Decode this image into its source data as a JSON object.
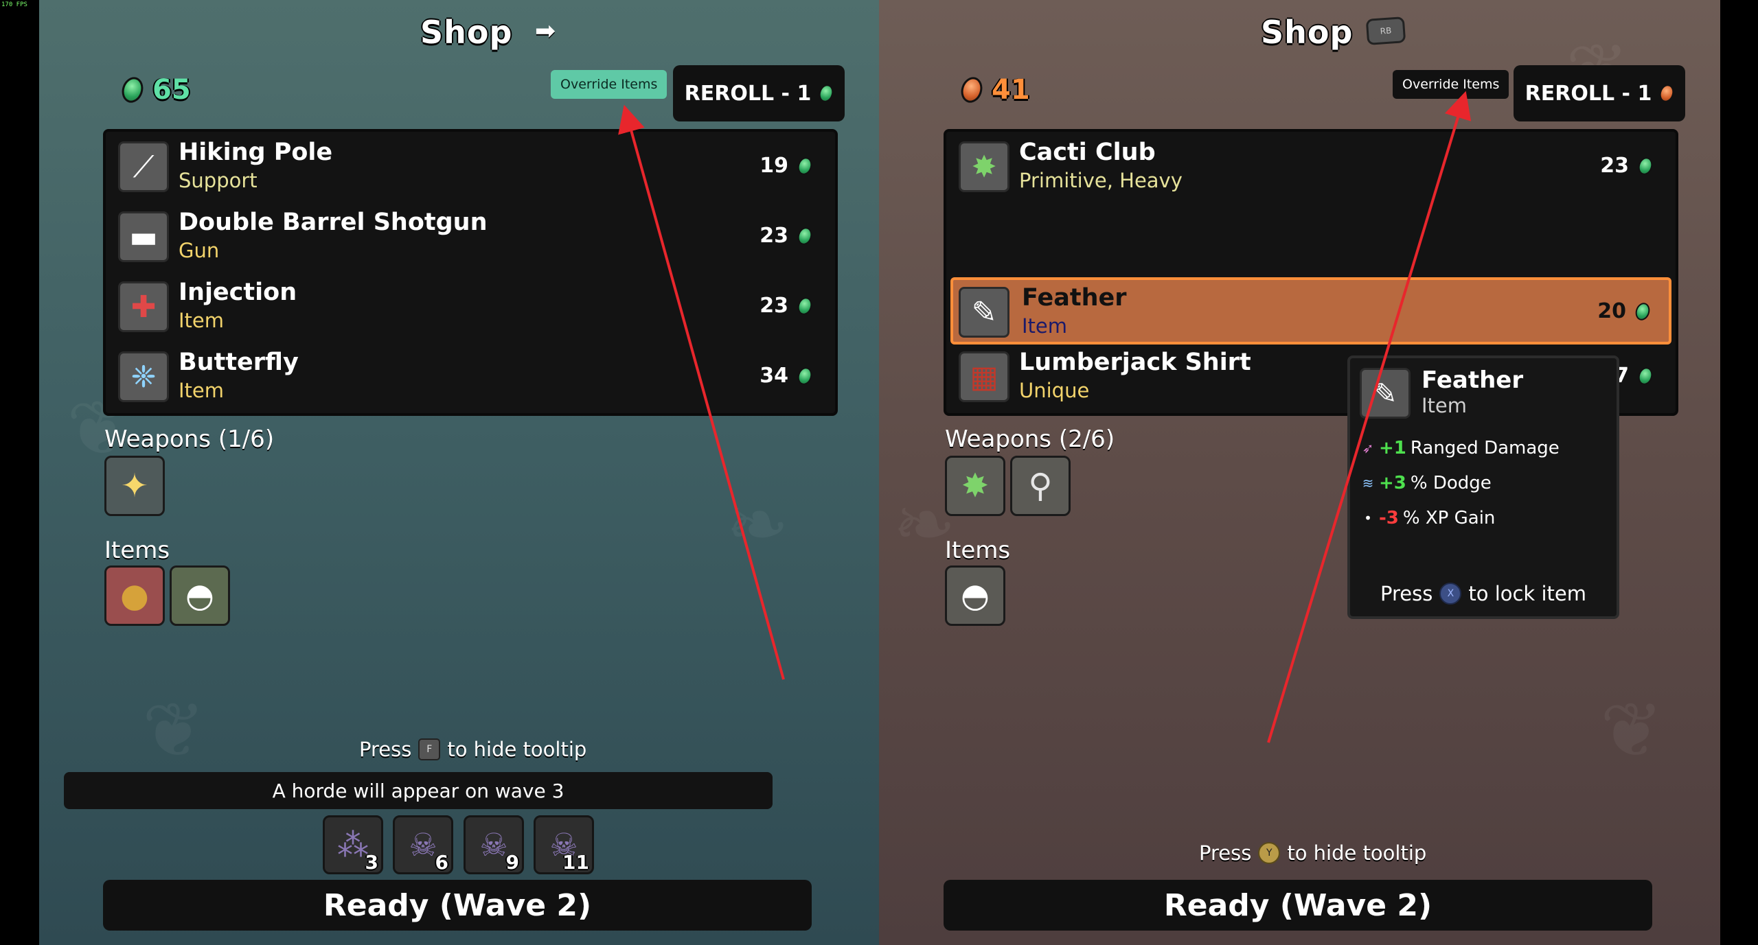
{
  "fps": "170 FPS",
  "colors": {
    "left_accent": "#5fc9a6",
    "right_accent": "#ff8f3a",
    "support_type": "#e6e29a",
    "arrow_red": "#e8262c"
  },
  "left": {
    "title": "Shop",
    "title_icon": "arrow-right-icon",
    "materials": "65",
    "override_label": "Override Items",
    "reroll_label": "REROLL - 1",
    "items": [
      {
        "name": "Hiking Pole",
        "type": "Support",
        "price": "19",
        "icon": "hiking-pole-icon"
      },
      {
        "name": "Double Barrel Shotgun",
        "type": "Gun",
        "price": "23",
        "icon": "shotgun-icon"
      },
      {
        "name": "Injection",
        "type": "Item",
        "price": "23",
        "icon": "syringe-icon"
      },
      {
        "name": "Butterfly",
        "type": "Item",
        "price": "34",
        "icon": "butterfly-icon"
      }
    ],
    "weapons_label": "Weapons (1/6)",
    "items_label": "Items",
    "press_prefix": "Press",
    "press_key": "F",
    "press_suffix": "to hide tooltip",
    "horde_text": "A horde will appear on wave 3",
    "enemies": [
      "3",
      "6",
      "9",
      "11"
    ],
    "ready_label": "Ready (Wave 2)"
  },
  "right": {
    "title": "Shop",
    "title_icon": "rb-button-icon",
    "title_icon_label": "RB",
    "materials": "41",
    "override_label": "Override Items",
    "reroll_label": "REROLL - 1",
    "items": [
      {
        "name": "Cacti Club",
        "type": "Primitive, Heavy",
        "price": "23",
        "icon": "cacti-club-icon"
      },
      {
        "name": "Feather",
        "type": "Item",
        "price": "20",
        "icon": "feather-icon"
      },
      {
        "name": "Lumberjack Shirt",
        "type": "Unique",
        "price": "7",
        "icon": "shirt-icon"
      }
    ],
    "weapons_label": "Weapons (2/6)",
    "items_label": "Items",
    "press_prefix": "Press",
    "press_key": "Y",
    "press_suffix": "to hide tooltip",
    "ready_label": "Ready (Wave 2)",
    "tooltip": {
      "name": "Feather",
      "type": "Item",
      "stats": [
        {
          "value": "+1",
          "label": "Ranged Damage",
          "icon": "ranged-damage-icon"
        },
        {
          "value": "+3",
          "label": "% Dodge",
          "icon": "dodge-icon"
        },
        {
          "value": "-3",
          "label": "% XP Gain",
          "icon": "xp-dot-icon"
        }
      ],
      "press_prefix": "Press",
      "press_key": "X",
      "press_suffix": "to lock item"
    }
  }
}
